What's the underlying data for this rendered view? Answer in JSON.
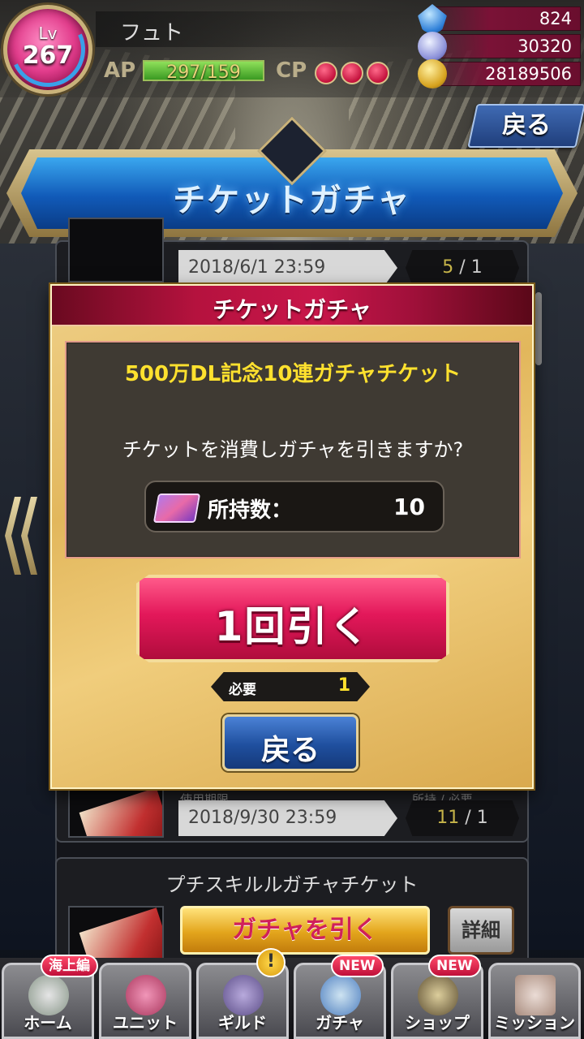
{
  "player": {
    "level_label": "Lv",
    "level": "267",
    "name": "フュト",
    "ap_label": "AP",
    "ap_value": "297/159",
    "ap_fill": 1.0,
    "cp_label": "CP",
    "cp_points": 3
  },
  "resources": [
    {
      "icon": "gem-icon",
      "value": "824"
    },
    {
      "icon": "crystal-icon",
      "value": "30320"
    },
    {
      "icon": "coin-icon",
      "value": "28189506"
    }
  ],
  "top_back_label": "戻る",
  "banner_title": "チケットガチャ",
  "list": {
    "card1": {
      "date": "2018/6/1 23:59",
      "owned": "5",
      "sep": "/",
      "need": "1"
    },
    "card2": {
      "expiry_label": "使用期限",
      "own_need_label": "所持 / 必要",
      "date": "2018/9/30 23:59",
      "owned": "11",
      "sep": "/",
      "need": "1"
    },
    "card3": {
      "title": "プチスキルルガチャチケット",
      "pull_label": "ガチャを引く",
      "detail_label": "詳細"
    }
  },
  "modal": {
    "title": "チケットガチャ",
    "ticket_name": "500万DL記念10連ガチャチケット",
    "confirm_text": "チケットを消費しガチャを引きますか?",
    "owned_label": "所持数：",
    "owned_value": "10",
    "pull_once_label": "1回引く",
    "required_label": "必要",
    "required_value": "1",
    "back_label": "戻る"
  },
  "nav": [
    {
      "label": "ホーム",
      "badge": "海上編",
      "icon": "home-icon"
    },
    {
      "label": "ユニット",
      "badge": "",
      "icon": "unit-icon"
    },
    {
      "label": "ギルド",
      "badge": "!",
      "icon": "guild-icon"
    },
    {
      "label": "ガチャ",
      "badge": "NEW",
      "icon": "gacha-icon"
    },
    {
      "label": "ショップ",
      "badge": "NEW",
      "icon": "shop-icon"
    },
    {
      "label": "ミッション",
      "badge": "",
      "icon": "mission-icon"
    }
  ],
  "colors": {
    "accent_red": "#c8164a",
    "accent_gold": "#ffe12e",
    "button_blue": "#1f4f9e"
  }
}
